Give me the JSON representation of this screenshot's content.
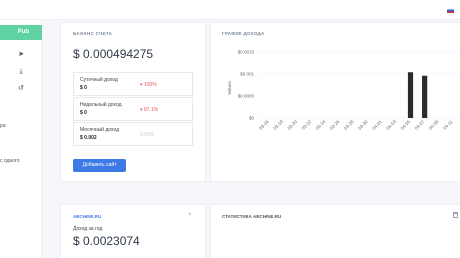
{
  "header": {
    "flag_icon": "russian-flag-icon"
  },
  "sidebar": {
    "pub_label": "Pub",
    "icons": [
      "send-icon",
      "download-icon",
      "history-icon"
    ],
    "text_fragments": [
      "ра",
      "с одного"
    ]
  },
  "balance_card": {
    "title": "БАЛАНС СЧЕТА",
    "balance": "$ 0.000494275",
    "rows": [
      {
        "label": "Суточный доход",
        "value": "$ 0",
        "change": "100%"
      },
      {
        "label": "Недельный доход",
        "value": "$ 0",
        "change": "97.1%"
      },
      {
        "label": "Месячный доход",
        "value": "$ 0.002",
        "change": "0.00%"
      }
    ],
    "add_site_label": "Добавить сайт"
  },
  "chart_card": {
    "title": "ГРАФИК ДОХОДА"
  },
  "chart_data": {
    "type": "bar",
    "ylabel": "Values",
    "ylim": [
      0,
      0.0015
    ],
    "yticks": [
      "$0",
      "$0.0005",
      "$0.001",
      "$0.0015"
    ],
    "categories": [
      "03-16",
      "03-18",
      "03-20",
      "03-22",
      "03-24",
      "03-26",
      "03-28",
      "03-30",
      "04-01",
      "04-03",
      "04-05",
      "04-07",
      "04-09",
      "04-11"
    ],
    "values": [
      0,
      0,
      0,
      0,
      0,
      0,
      0,
      0,
      0,
      0,
      0.00104,
      0.00096,
      0,
      0
    ],
    "bar_color": "#2b2b2b",
    "grid": true
  },
  "site_card": {
    "site_name": "ABCHINE.RU",
    "year_label": "Доход за год",
    "year_value": "$ 0.0023074",
    "close_icon": "close-icon"
  },
  "stats_card": {
    "title": "СТАТИСТИКА ABCHINE.RU",
    "delete_icon": "trash-icon"
  }
}
